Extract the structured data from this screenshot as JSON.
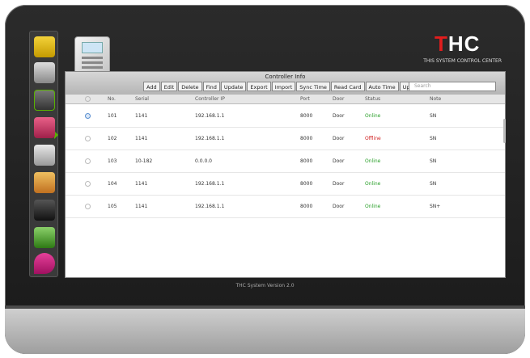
{
  "brand": {
    "name_red": "T",
    "name_rest": "HC",
    "subtitle": "THIS SYSTEM CONTROL CENTER"
  },
  "sidebar": {
    "items": [
      "door-panel",
      "camera",
      "access-controller",
      "car",
      "card-reader",
      "keys",
      "elevator",
      "door",
      "location"
    ]
  },
  "panel": {
    "title": "Controller Info",
    "tabs": [
      "Add",
      "Edit",
      "Delete",
      "Find",
      "Update",
      "Export",
      "Import",
      "Sync Time",
      "Read Card",
      "Auto Time",
      "Upload"
    ],
    "search_placeholder": "Search"
  },
  "table": {
    "headers": [
      "No.",
      "Serial",
      "Controller IP",
      "Port",
      "Door",
      "Status",
      "Note"
    ],
    "rows": [
      {
        "no": "101",
        "serial": "1141",
        "ip": "192.168.1.1",
        "port": "8000",
        "door": "Door",
        "status": "Online",
        "note": "SN"
      },
      {
        "no": "102",
        "serial": "1141",
        "ip": "192.168.1.1",
        "port": "8000",
        "door": "Door",
        "status": "Offline",
        "note": "SN"
      },
      {
        "no": "103",
        "serial": "10-182",
        "ip": "0.0.0.0",
        "port": "8000",
        "door": "Door",
        "status": "Online",
        "note": "SN"
      },
      {
        "no": "104",
        "serial": "1141",
        "ip": "192.168.1.1",
        "port": "8000",
        "door": "Door",
        "status": "Online",
        "note": "SN"
      },
      {
        "no": "105",
        "serial": "1141",
        "ip": "192.168.1.1",
        "port": "8000",
        "door": "Door",
        "status": "Online",
        "note": "SN+"
      }
    ]
  },
  "footer": "THC System Version 2.0",
  "colors": {
    "accent": "#e21d1d",
    "online": "#2aa02a",
    "offline": "#d02020"
  }
}
